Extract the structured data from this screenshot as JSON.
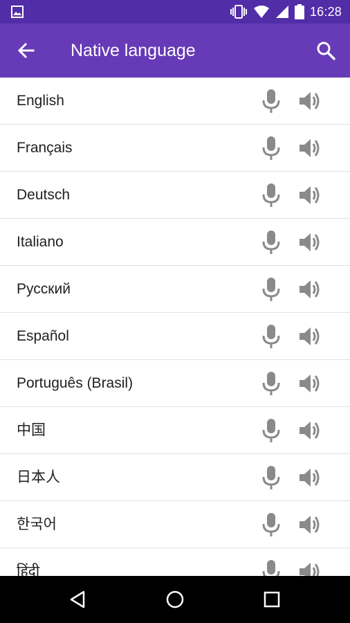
{
  "status_bar": {
    "time": "16:28"
  },
  "app_bar": {
    "title": "Native language"
  },
  "languages": [
    {
      "label": "English"
    },
    {
      "label": "Français"
    },
    {
      "label": "Deutsch"
    },
    {
      "label": "Italiano"
    },
    {
      "label": "Русский"
    },
    {
      "label": "Español"
    },
    {
      "label": "Português (Brasil)"
    },
    {
      "label": "中国"
    },
    {
      "label": "日本人"
    },
    {
      "label": "한국어"
    },
    {
      "label": "हिंदी"
    }
  ],
  "icons": {
    "status": [
      "image-icon",
      "vibrate-icon",
      "wifi-icon",
      "signal-icon",
      "battery-icon"
    ],
    "row": [
      "mic-icon",
      "speaker-icon"
    ],
    "nav": [
      "back-triangle-icon",
      "home-circle-icon",
      "recents-square-icon"
    ]
  },
  "colors": {
    "status_bar": "#512da8",
    "app_bar": "#673ab7",
    "icon_gray": "#8a8a8a",
    "text": "#212121",
    "divider": "#e0e0e0"
  }
}
